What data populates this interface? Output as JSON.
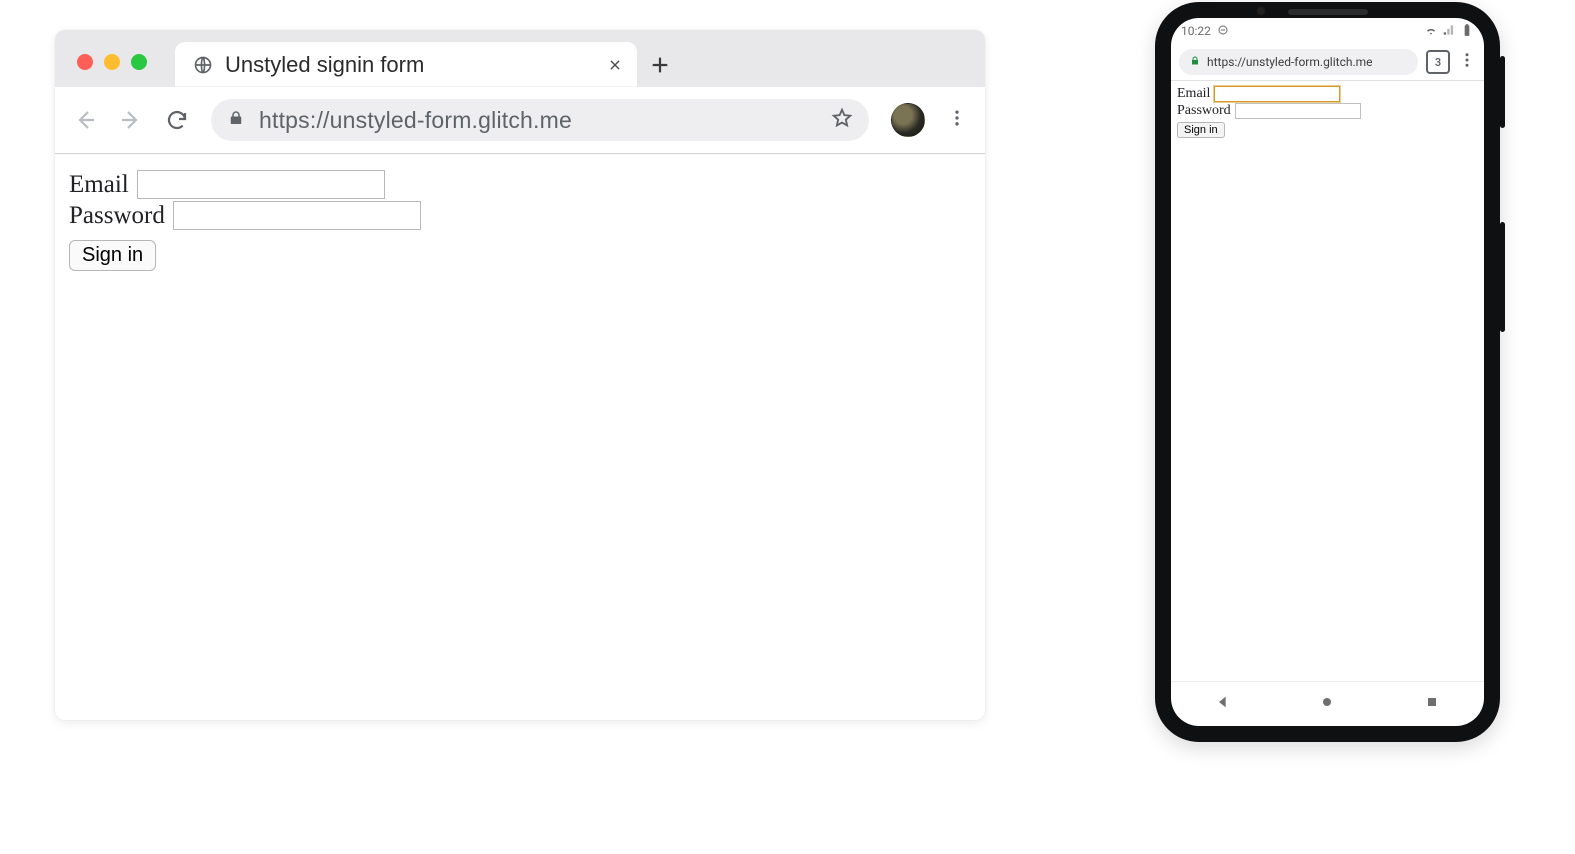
{
  "desktop": {
    "tab_title": "Unstyled signin form",
    "url": "https://unstyled-form.glitch.me",
    "form": {
      "email_label": "Email",
      "password_label": "Password",
      "submit_label": "Sign in"
    }
  },
  "phone": {
    "status_time": "10:22",
    "tab_count": "3",
    "url": "https://unstyled-form.glitch.me",
    "form": {
      "email_label": "Email",
      "password_label": "Password",
      "submit_label": "Sign in"
    }
  }
}
